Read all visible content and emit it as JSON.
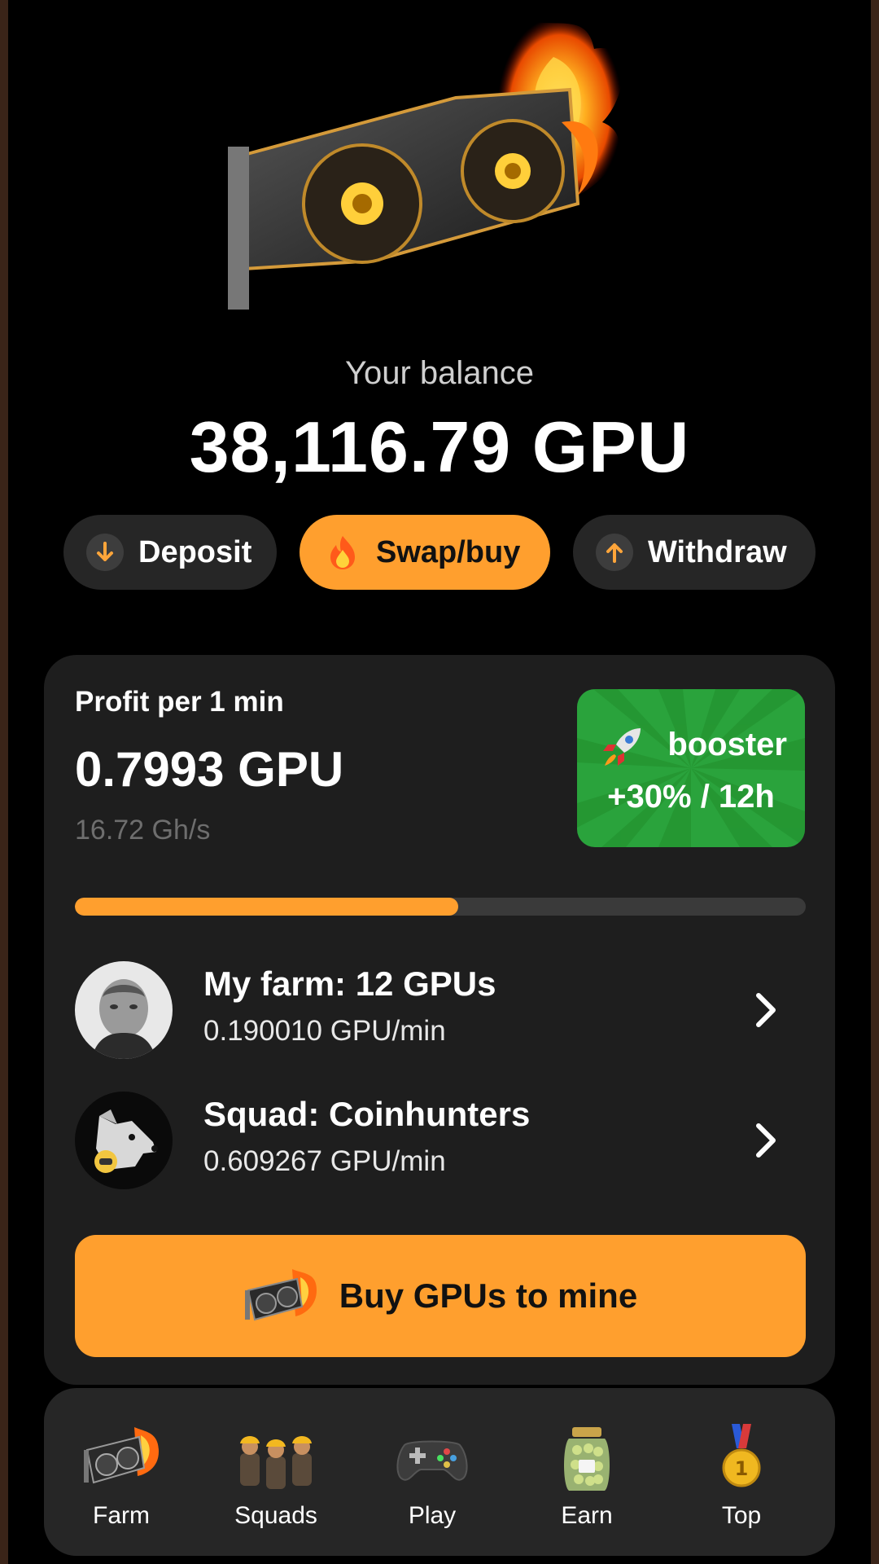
{
  "balance": {
    "label": "Your balance",
    "value": "38,116.79 GPU"
  },
  "actions": {
    "deposit": "Deposit",
    "swap": "Swap/buy",
    "withdraw": "Withdraw"
  },
  "profit": {
    "label": "Profit per 1 min",
    "value": "0.7993 GPU",
    "hashrate": "16.72 Gh/s",
    "progress_percent": 52.5
  },
  "booster": {
    "line1": "booster",
    "line2": "+30% / 12h"
  },
  "rows": [
    {
      "title": "My farm: 12 GPUs",
      "subtitle": "0.190010 GPU/min"
    },
    {
      "title": "Squad: Coinhunters",
      "subtitle": "0.609267 GPU/min"
    }
  ],
  "buy_button": "Buy GPUs to mine",
  "nav": [
    {
      "label": "Farm",
      "icon": "gpu-fire-icon"
    },
    {
      "label": "Squads",
      "icon": "miners-icon"
    },
    {
      "label": "Play",
      "icon": "gamepad-icon"
    },
    {
      "label": "Earn",
      "icon": "jar-icon"
    },
    {
      "label": "Top",
      "icon": "medal-icon"
    }
  ],
  "colors": {
    "accent": "#ff9f2e",
    "booster": "#2aa33c",
    "card": "#1e1e1e",
    "background": "#000000"
  }
}
